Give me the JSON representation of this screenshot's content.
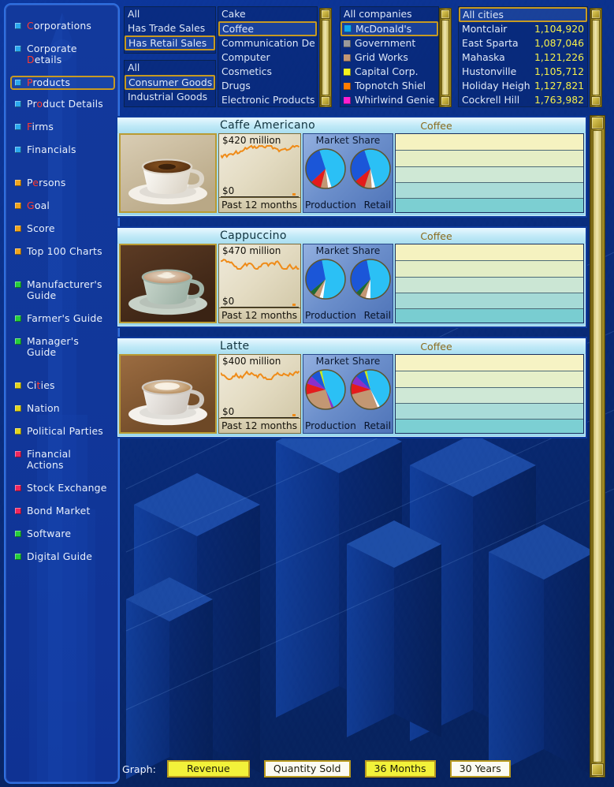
{
  "sidebar": {
    "items": [
      {
        "label": "Corporations",
        "hotkey": "C",
        "color": "#2aa8ee",
        "selected": false
      },
      {
        "label": "Corporate Details",
        "hotkey": "D",
        "color": "#2aa8ee",
        "selected": false
      },
      {
        "label": "Products",
        "hotkey": "P",
        "color": "#2aa8ee",
        "selected": true
      },
      {
        "label": "Product Details",
        "hotkey": "o",
        "color": "#2aa8ee",
        "selected": false
      },
      {
        "label": "Firms",
        "hotkey": "F",
        "color": "#2aa8ee",
        "selected": false
      },
      {
        "label": "Financials",
        "hotkey": "",
        "color": "#2aa8ee",
        "selected": false
      },
      {
        "label": "GAP",
        "hotkey": "",
        "color": "",
        "selected": false
      },
      {
        "label": "Persons",
        "hotkey": "e",
        "color": "#f0a41c",
        "selected": false
      },
      {
        "label": "Goal",
        "hotkey": "G",
        "color": "#f0a41c",
        "selected": false
      },
      {
        "label": "Score",
        "hotkey": "",
        "color": "#f0a41c",
        "selected": false
      },
      {
        "label": "Top 100 Charts",
        "hotkey": "",
        "color": "#f0a41c",
        "selected": false
      },
      {
        "label": "GAP",
        "hotkey": "",
        "color": "",
        "selected": false
      },
      {
        "label": "Manufacturer's Guide",
        "hotkey": "",
        "color": "#24cf3a",
        "selected": false
      },
      {
        "label": "Farmer's Guide",
        "hotkey": "",
        "color": "#24cf3a",
        "selected": false
      },
      {
        "label": "Manager's Guide",
        "hotkey": "",
        "color": "#24cf3a",
        "selected": false
      },
      {
        "label": "GAP",
        "hotkey": "",
        "color": "",
        "selected": false
      },
      {
        "label": "Cities",
        "hotkey": "t",
        "color": "#e2d41c",
        "selected": false
      },
      {
        "label": "Nation",
        "hotkey": "",
        "color": "#e2d41c",
        "selected": false
      },
      {
        "label": "Political Parties",
        "hotkey": "",
        "color": "#e2d41c",
        "selected": false
      },
      {
        "label": "Financial Actions",
        "hotkey": "",
        "color": "#f0265e",
        "selected": false
      },
      {
        "label": "Stock Exchange",
        "hotkey": "",
        "color": "#f0265e",
        "selected": false
      },
      {
        "label": "Bond Market",
        "hotkey": "",
        "color": "#f0265e",
        "selected": false
      },
      {
        "label": "Software",
        "hotkey": "",
        "color": "#24cf3a",
        "selected": false
      },
      {
        "label": "Digital Guide",
        "hotkey": "",
        "color": "#24cf3a",
        "selected": false
      }
    ]
  },
  "filters": {
    "sales_filter": {
      "options": [
        "All",
        "Has Trade Sales",
        "Has Retail Sales"
      ],
      "selected": "Has Retail Sales"
    },
    "goods_filter": {
      "options": [
        "All",
        "Consumer Goods",
        "Industrial Goods"
      ],
      "selected": "Consumer Goods"
    },
    "product_list": {
      "options": [
        "Cake",
        "Coffee",
        "Communication De",
        "Computer",
        "Cosmetics",
        "Drugs",
        "Electronic Products"
      ],
      "selected": "Coffee"
    },
    "company_list": {
      "header": "All companies",
      "selected": "McDonald's",
      "items": [
        {
          "name": "McDonald's",
          "color": "#0fa8ee"
        },
        {
          "name": "Government",
          "color": "#9a9a9a"
        },
        {
          "name": "Grid Works",
          "color": "#c39773"
        },
        {
          "name": "Capital Corp.",
          "color": "#f2f21e"
        },
        {
          "name": "Topnotch Shiel",
          "color": "#ff7c00"
        },
        {
          "name": "Whirlwind Genie",
          "color": "#ff1fcf"
        }
      ]
    },
    "city_list": {
      "header": "All cities",
      "items": [
        {
          "name": "Montclair",
          "population": "1,104,920"
        },
        {
          "name": "East Sparta",
          "population": "1,087,046"
        },
        {
          "name": "Mahaska",
          "population": "1,121,226"
        },
        {
          "name": "Hustonville",
          "population": "1,105,712"
        },
        {
          "name": "Holiday Heigh",
          "population": "1,127,821"
        },
        {
          "name": "Cockrell Hill",
          "population": "1,763,982"
        }
      ]
    }
  },
  "products": [
    {
      "name": "Caffe Americano",
      "category": "Coffee",
      "revenue_top_label": "$420 million",
      "revenue_zero_label": "$0",
      "revenue_period": "Past 12 months",
      "market_share_label": "Market Share",
      "pie_labels": {
        "left": "Production",
        "right": "Retail"
      },
      "production_share": [
        {
          "color": "#2bc0f5",
          "value": 45
        },
        {
          "color": "#ffffff",
          "value": 3
        },
        {
          "color": "#c39773",
          "value": 6
        },
        {
          "color": "#e41b1b",
          "value": 9
        },
        {
          "color": "#1b56d8",
          "value": 32
        },
        {
          "color": "#2bc0f5",
          "value": 5
        }
      ],
      "retail_share": [
        {
          "color": "#2bc0f5",
          "value": 46
        },
        {
          "color": "#ffffff",
          "value": 3
        },
        {
          "color": "#c39773",
          "value": 6
        },
        {
          "color": "#e41b1b",
          "value": 9
        },
        {
          "color": "#1b56d8",
          "value": 31
        },
        {
          "color": "#2bc0f5",
          "value": 5
        }
      ]
    },
    {
      "name": "Cappuccino",
      "category": "Coffee",
      "revenue_top_label": "$470 million",
      "revenue_zero_label": "$0",
      "revenue_period": "Past 12 months",
      "market_share_label": "Market Share",
      "pie_labels": {
        "left": "Production",
        "right": "Retail"
      },
      "production_share": [
        {
          "color": "#2bc0f5",
          "value": 52
        },
        {
          "color": "#ffffff",
          "value": 3
        },
        {
          "color": "#c39773",
          "value": 5
        },
        {
          "color": "#1f6b33",
          "value": 4
        },
        {
          "color": "#1b56d8",
          "value": 33
        },
        {
          "color": "#2bc0f5",
          "value": 3
        }
      ],
      "retail_share": [
        {
          "color": "#2bc0f5",
          "value": 50
        },
        {
          "color": "#ffffff",
          "value": 4
        },
        {
          "color": "#c39773",
          "value": 5
        },
        {
          "color": "#1f6b33",
          "value": 4
        },
        {
          "color": "#1b56d8",
          "value": 34
        },
        {
          "color": "#2bc0f5",
          "value": 3
        }
      ]
    },
    {
      "name": "Latte",
      "category": "Coffee",
      "revenue_top_label": "$400 million",
      "revenue_zero_label": "$0",
      "revenue_period": "Past 12 months",
      "market_share_label": "Market Share",
      "pie_labels": {
        "left": "Production",
        "right": "Retail"
      },
      "production_share": [
        {
          "color": "#2bc0f5",
          "value": 43
        },
        {
          "color": "#8b2fc9",
          "value": 2
        },
        {
          "color": "#c39773",
          "value": 26
        },
        {
          "color": "#e41b1b",
          "value": 9
        },
        {
          "color": "#8b2fc9",
          "value": 7
        },
        {
          "color": "#1b56d8",
          "value": 8
        },
        {
          "color": "#c8e81e",
          "value": 2
        },
        {
          "color": "#2bc0f5",
          "value": 3
        }
      ],
      "retail_share": [
        {
          "color": "#2bc0f5",
          "value": 42
        },
        {
          "color": "#ffffff",
          "value": 2
        },
        {
          "color": "#c39773",
          "value": 27
        },
        {
          "color": "#e41b1b",
          "value": 9
        },
        {
          "color": "#8b2fc9",
          "value": 7
        },
        {
          "color": "#1b56d8",
          "value": 8
        },
        {
          "color": "#c8e81e",
          "value": 2
        },
        {
          "color": "#2bc0f5",
          "value": 3
        }
      ]
    }
  ],
  "bottom_bar": {
    "graph_label": "Graph:",
    "buttons": [
      {
        "label": "Revenue",
        "active": true
      },
      {
        "label": "Quantity Sold",
        "active": false
      },
      {
        "label": "36 Months",
        "active": true
      },
      {
        "label": "30 Years",
        "active": false
      }
    ]
  },
  "colors": {
    "accent_gold": "#c79a22",
    "panel_blue": "#12399c",
    "card_cyan": "#a8e0f2",
    "highlight_yellow": "#f2f23a"
  }
}
